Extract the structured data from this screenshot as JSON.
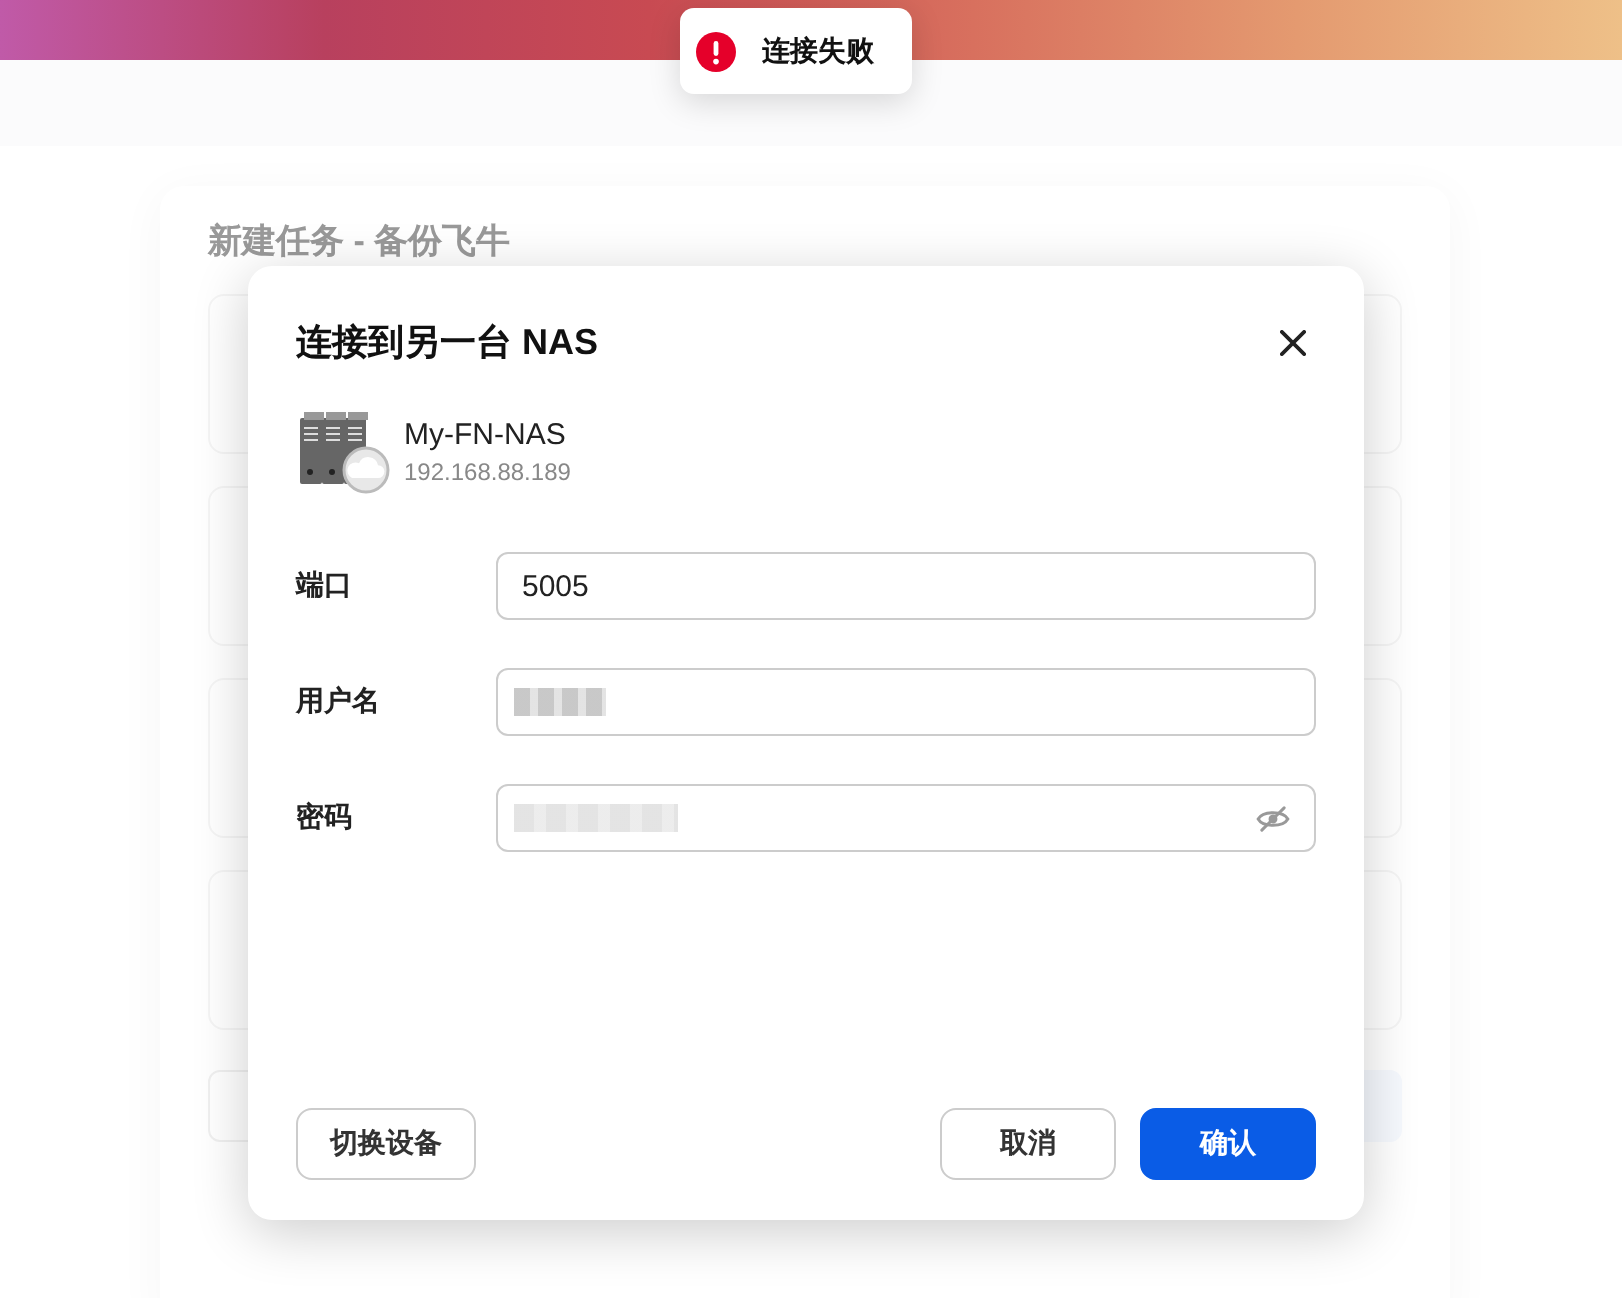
{
  "background_dialog": {
    "title": "新建任务 - 备份飞牛"
  },
  "toast": {
    "kind": "error",
    "message": "连接失败"
  },
  "dialog": {
    "title": "连接到另一台 NAS",
    "device": {
      "name": "My-FN-NAS",
      "address": "192.168.88.189"
    },
    "fields": [
      {
        "label": "端口",
        "kind": "text",
        "value": "5005"
      },
      {
        "label": "用户名",
        "kind": "redacted"
      },
      {
        "label": "密码",
        "kind": "password",
        "password_hidden": true
      }
    ],
    "left_buttons": [
      {
        "label": "切换设备",
        "kind": "secondary"
      }
    ],
    "right_buttons": [
      {
        "label": "取消",
        "kind": "secondary"
      },
      {
        "label": "确认",
        "kind": "primary"
      }
    ]
  }
}
